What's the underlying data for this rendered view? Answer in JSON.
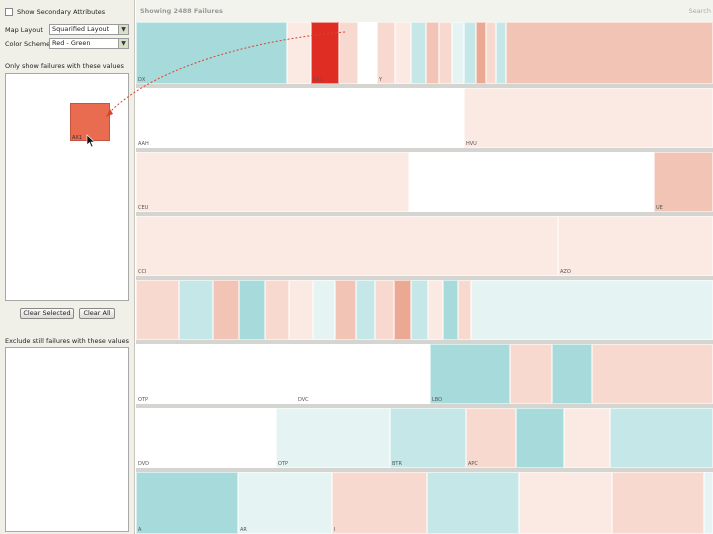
{
  "left_panel": {
    "secondary_attributes_label": "Show Secondary Attributes",
    "map_layout_label": "Map Layout",
    "map_layout_value": "Squarified Layout",
    "color_scheme_label": "Color Scheme",
    "color_scheme_value": "Red - Green",
    "include_heading": "Only show failures with these values",
    "dragged_item_label": "AX1",
    "clear_selected_label": "Clear Selected",
    "clear_all_label": "Clear All",
    "exclude_heading": "Exclude still failures with these values"
  },
  "header": {
    "title": "Showing 2488 Failures",
    "search_label": "Search"
  },
  "treemap": {
    "palette": {
      "W": "#ffffff",
      "P1": "#fbe9e3",
      "P2": "#f8d9cf",
      "P3": "#f2c4b5",
      "P4": "#eba893",
      "P5": "#e1846c",
      "R": "#e02d24",
      "T1": "#e5f3f3",
      "T2": "#c6e7e7",
      "T3": "#a6dadb",
      "T4": "#86cccd"
    },
    "rows": [
      {
        "cells": [
          {
            "label": "DX",
            "c": "T3"
          },
          {
            "label": "",
            "c": "P1"
          },
          {
            "label": "AX1",
            "c": "R"
          },
          {
            "label": "",
            "c": "P2"
          },
          {
            "label": "",
            "c": "W"
          },
          {
            "label": "Y",
            "c": "P2"
          },
          {
            "label": "",
            "c": "P1"
          },
          {
            "label": "",
            "c": "T2"
          },
          {
            "label": "",
            "c": "P3"
          },
          {
            "label": "",
            "c": "P2"
          },
          {
            "label": "",
            "c": "T1"
          },
          {
            "label": "",
            "c": "T2"
          },
          {
            "label": "",
            "c": "P4"
          },
          {
            "label": "",
            "c": "P2"
          },
          {
            "label": "",
            "c": "T2"
          },
          {
            "label": "",
            "c": "P3"
          }
        ]
      },
      {
        "cells": [
          {
            "label": "AAH",
            "c": "W"
          },
          {
            "label": "HVU",
            "c": "P1"
          }
        ]
      },
      {
        "cells": [
          {
            "label": "CEU",
            "c": "P1"
          },
          {
            "label": "",
            "c": "W"
          },
          {
            "label": "UE",
            "c": "P3"
          }
        ]
      },
      {
        "cells": [
          {
            "label": "CCI",
            "c": "P1"
          },
          {
            "label": "AZO",
            "c": "P1"
          }
        ]
      },
      {
        "cells": [
          {
            "label": "",
            "c": "P2"
          },
          {
            "label": "",
            "c": "T2"
          },
          {
            "label": "",
            "c": "P3"
          },
          {
            "label": "",
            "c": "T3"
          },
          {
            "label": "",
            "c": "P2"
          },
          {
            "label": "",
            "c": "P1"
          },
          {
            "label": "",
            "c": "T1"
          },
          {
            "label": "",
            "c": "P3"
          },
          {
            "label": "",
            "c": "T2"
          },
          {
            "label": "",
            "c": "P2"
          },
          {
            "label": "",
            "c": "P4"
          },
          {
            "label": "",
            "c": "T2"
          },
          {
            "label": "",
            "c": "P1"
          },
          {
            "label": "",
            "c": "T3"
          },
          {
            "label": "",
            "c": "P2"
          },
          {
            "label": "",
            "c": "T1"
          }
        ]
      },
      {
        "cells": [
          {
            "label": "OTP",
            "c": "W"
          },
          {
            "label": "DVC",
            "c": "W"
          },
          {
            "label": "LBO",
            "c": "T3"
          },
          {
            "label": "",
            "c": "P2"
          },
          {
            "label": "",
            "c": "T3"
          },
          {
            "label": "",
            "c": "P2"
          }
        ]
      },
      {
        "cells": [
          {
            "label": "DVD",
            "c": "W"
          },
          {
            "label": "OTP",
            "c": "T1"
          },
          {
            "label": "BTR",
            "c": "T2"
          },
          {
            "label": "APC",
            "c": "P2"
          },
          {
            "label": "",
            "c": "T3"
          },
          {
            "label": "",
            "c": "P1"
          },
          {
            "label": "",
            "c": "T2"
          }
        ]
      },
      {
        "cells": [
          {
            "label": "A",
            "c": "T3"
          },
          {
            "label": "AR",
            "c": "T1"
          },
          {
            "label": "I",
            "c": "P2"
          },
          {
            "label": "",
            "c": "T2"
          },
          {
            "label": "",
            "c": "P1"
          },
          {
            "label": "",
            "c": "P2"
          },
          {
            "label": "",
            "c": "T1"
          }
        ]
      }
    ]
  }
}
